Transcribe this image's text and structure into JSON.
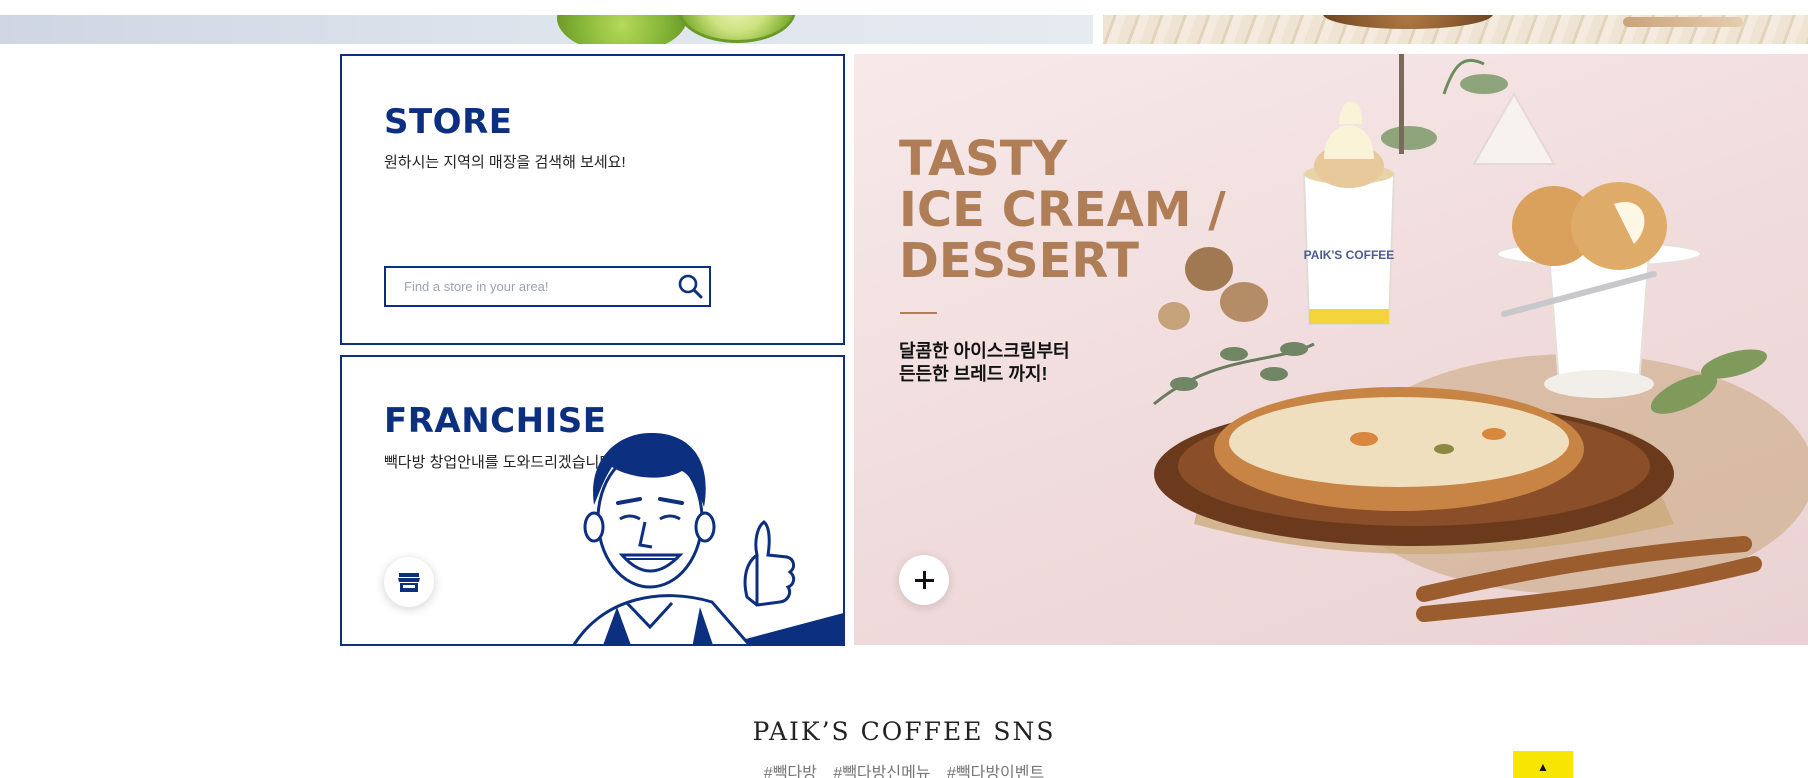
{
  "store": {
    "title": "STORE",
    "description": "원하시는 지역의 매장을 검색해 보세요!",
    "search_placeholder": "Find a store in your area!",
    "search_icon": "search-icon"
  },
  "franchise": {
    "title": "FRANCHISE",
    "description": "빽다방 창업안내를 도와드리겠습니다.",
    "button_icon": "store-icon"
  },
  "promo": {
    "title_lines": [
      "TASTY",
      "ICE CREAM /",
      "DESSERT"
    ],
    "description_lines": [
      "달콤한 아이스크림부터",
      "든든한 브레드 까지!"
    ],
    "cup_label": "PAIK'S COFFEE",
    "more_icon": "plus-icon"
  },
  "sns": {
    "title": "PAIK’S COFFEE SNS",
    "tags": [
      "#빽다방",
      "#빽다방신메뉴",
      "#빽다방이벤트"
    ]
  },
  "top_button": {
    "label": "▲"
  },
  "colors": {
    "brand_navy": "#0d2f7f",
    "promo_brown": "#b07e56",
    "top_button_yellow": "#f6e600"
  }
}
